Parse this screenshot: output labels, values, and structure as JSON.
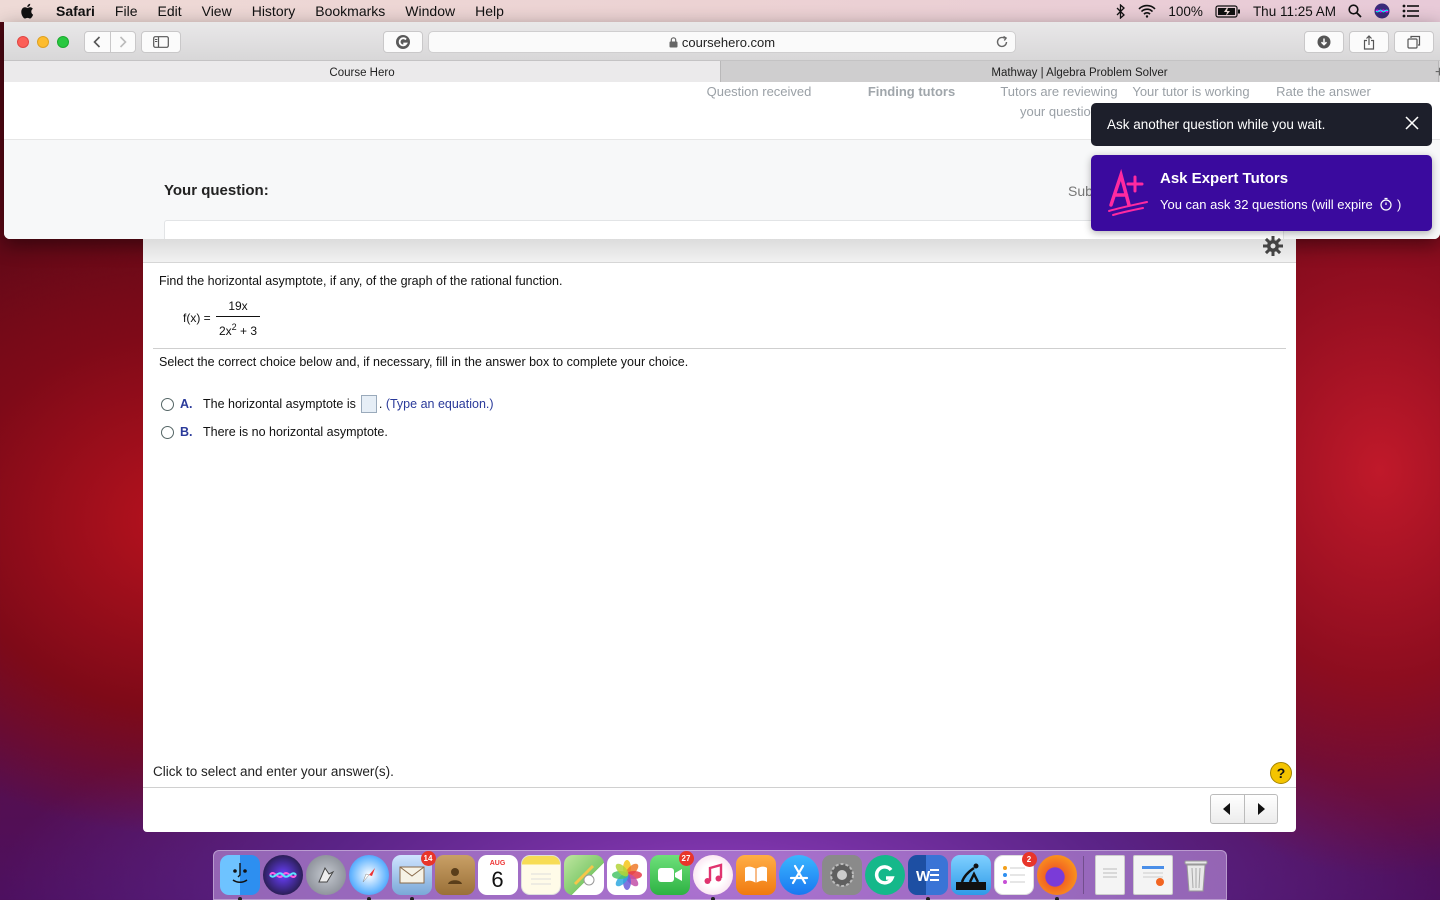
{
  "menubar": {
    "app": "Safari",
    "items": [
      "File",
      "Edit",
      "View",
      "History",
      "Bookmarks",
      "Window",
      "Help"
    ],
    "battery": "100%",
    "clock": "Thu 11:25 AM"
  },
  "browser": {
    "url": "coursehero.com",
    "tabs": [
      {
        "label": "Course Hero",
        "active": true
      },
      {
        "label": "Mathway | Algebra Problem Solver",
        "active": false
      }
    ],
    "new_tab": "+"
  },
  "coursehero": {
    "steps": [
      {
        "label": "Question received"
      },
      {
        "label": "Finding tutors"
      },
      {
        "label": "Tutors are reviewing your question"
      },
      {
        "label": "Your tutor is working"
      },
      {
        "label": "Rate the answer"
      }
    ],
    "your_question_label": "Your question:",
    "sub_label": "Sub"
  },
  "toast": {
    "message": "Ask another question while you wait.",
    "promo_title": "Ask Expert Tutors",
    "promo_text": "You can ask 32 questions (will expire",
    "colors": {
      "dark": "#1d1f2b",
      "purple": "#3a0a9e",
      "accent": "#e0107a"
    }
  },
  "problem": {
    "question": "Find the horizontal asymptote, if any, of the graph of the rational function.",
    "function_lhs": "f(x) =",
    "numerator": "19x",
    "denominator_base": "2x",
    "denominator_exp": "2",
    "denominator_rest": " + 3",
    "instructions": "Select the correct choice below and, if necessary, fill in the answer box to complete your choice.",
    "choices": [
      {
        "letter": "A.",
        "text": "The horizontal asymptote is",
        "after_box": ".",
        "hint": "(Type an equation.)"
      },
      {
        "letter": "B.",
        "text": "There is no horizontal asymptote."
      }
    ],
    "footer": "Click to select and enter your answer(s).",
    "help": "?"
  },
  "dock": {
    "apps": [
      {
        "name": "finder",
        "color": "#2d8ff0"
      },
      {
        "name": "siri",
        "color": "#2a2a6a"
      },
      {
        "name": "launchpad",
        "color": "#8a8f99"
      },
      {
        "name": "safari",
        "color": "#1f7df0"
      },
      {
        "name": "mail",
        "color": "#7aa8d8",
        "badge": "14"
      },
      {
        "name": "contacts",
        "color": "#b58a4a"
      },
      {
        "name": "calendar",
        "color": "#ffffff",
        "month": "AUG",
        "day": "6"
      },
      {
        "name": "notes",
        "color": "#f7dc55"
      },
      {
        "name": "maps",
        "color": "#7ec96a"
      },
      {
        "name": "photos",
        "color": "#ffffff"
      },
      {
        "name": "facetime",
        "color": "#3cc24b",
        "badge": "27"
      },
      {
        "name": "itunes",
        "color": "#f24a8f"
      },
      {
        "name": "books",
        "color": "#f08a1a"
      },
      {
        "name": "app-store",
        "color": "#1a8ff0"
      },
      {
        "name": "system-preferences",
        "color": "#777777"
      },
      {
        "name": "grammarly",
        "color": "#15b88a"
      },
      {
        "name": "word",
        "color": "#2b5bb8"
      },
      {
        "name": "kindle",
        "color": "#111111"
      },
      {
        "name": "reminders",
        "color": "#ffffff",
        "badge": "2"
      },
      {
        "name": "firefox",
        "color": "#f26522"
      },
      {
        "name": "document",
        "color": "#f2f2f2"
      },
      {
        "name": "firefox-document",
        "color": "#f2f2f2"
      },
      {
        "name": "trash",
        "color": "#d8d8d8"
      }
    ]
  }
}
